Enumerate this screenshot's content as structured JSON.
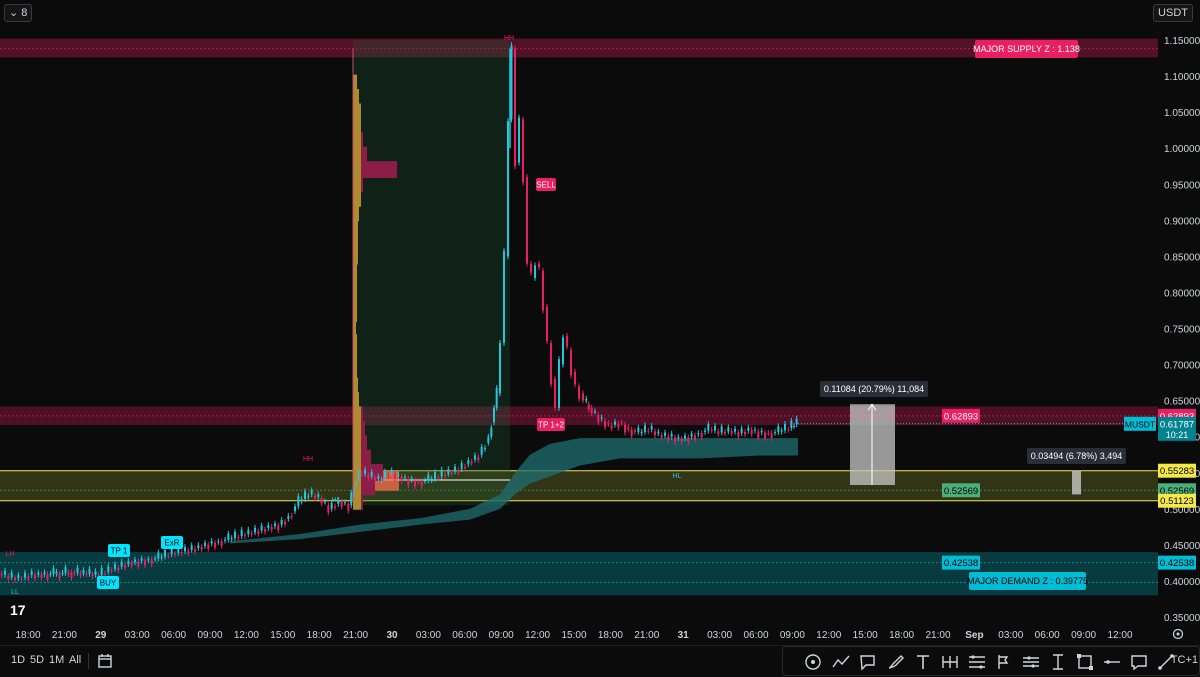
{
  "toolbar": {
    "menu_label": "8",
    "quote_currency": "USDT",
    "timeframes": [
      "1D",
      "5D",
      "1M",
      "All"
    ],
    "timezone": "TC+1"
  },
  "labels": {
    "major_supply": "MAJOR SUPPLY Z : 1.138",
    "major_demand": "MAJOR DEMAND Z : 0.39775",
    "sell": "SELL",
    "buy": "BUY",
    "tp1": "TP 1",
    "exit": "ExR",
    "tp12": "TP 1+2",
    "hh_top": "HH",
    "hh_left": "HH",
    "hl_left": "HL",
    "hl_right": "HL",
    "lh": "LH",
    "ll": "LL",
    "measure_top": "0.11084 (20.79%) 11,084",
    "measure_bottom": "0.03494 (6.78%) 3,494",
    "symbol": "MUSDT",
    "countdown": "10:21"
  },
  "colors": {
    "supply": "#e91e63",
    "demand": "#00bcd4",
    "yellow_line": "#f5e84c",
    "candle_up": "#26c6da",
    "candle_down": "#e91e63",
    "ribbon": "#1f6f72"
  },
  "chart_data": {
    "type": "candlestick",
    "pair": "MUSDT",
    "last_price": 0.61787,
    "y_ticks": [
      1.15,
      1.1,
      1.05,
      1.0,
      0.95,
      0.9,
      0.85,
      0.8,
      0.75,
      0.7,
      0.65,
      0.6,
      0.55,
      0.5,
      0.45,
      0.4,
      0.35
    ],
    "y_tick_labels": [
      "1.15000",
      "1.10000",
      "1.05000",
      "1.00000",
      "0.95000",
      "0.90000",
      "0.85000",
      "0.80000",
      "0.75000",
      "0.70000",
      "0.65000",
      "0.60000",
      "0.55000",
      "0.50000",
      "0.45000",
      "0.40000",
      "0.35000"
    ],
    "ylim": [
      0.33,
      1.175
    ],
    "x_ticks": [
      "18:00",
      "21:00",
      "29",
      "03:00",
      "06:00",
      "09:00",
      "12:00",
      "15:00",
      "18:00",
      "21:00",
      "30",
      "03:00",
      "06:00",
      "09:00",
      "12:00",
      "15:00",
      "18:00",
      "21:00",
      "31",
      "03:00",
      "06:00",
      "09:00",
      "12:00",
      "15:00",
      "18:00",
      "21:00",
      "Sep",
      "03:00",
      "06:00",
      "09:00",
      "12:00"
    ],
    "price_badges": [
      {
        "label": "0.62893",
        "value": 0.62893,
        "color": "#e91e63"
      },
      {
        "label": "0.55283",
        "value": 0.55283,
        "color": "#f5e84c"
      },
      {
        "label": "0.52569",
        "value": 0.52569,
        "color": "#4caf7a"
      },
      {
        "label": "0.51123",
        "value": 0.51123,
        "color": "#f5e84c"
      },
      {
        "label": "0.42538",
        "value": 0.42538,
        "color": "#00bcd4"
      }
    ],
    "zones": {
      "supply_major": [
        1.126,
        1.152
      ],
      "supply_minor": [
        0.616,
        0.642
      ],
      "yellow": [
        0.51123,
        0.55283
      ],
      "demand": [
        0.38,
        0.44
      ]
    },
    "price_path": [
      [
        0,
        0.41
      ],
      [
        10,
        0.405
      ],
      [
        20,
        0.403
      ],
      [
        30,
        0.408
      ],
      [
        40,
        0.409
      ],
      [
        55,
        0.41
      ],
      [
        70,
        0.412
      ],
      [
        85,
        0.41
      ],
      [
        100,
        0.408
      ],
      [
        110,
        0.415
      ],
      [
        120,
        0.42
      ],
      [
        130,
        0.425
      ],
      [
        140,
        0.428
      ],
      [
        150,
        0.43
      ],
      [
        160,
        0.432
      ],
      [
        170,
        0.437
      ],
      [
        180,
        0.44
      ],
      [
        190,
        0.443
      ],
      [
        200,
        0.447
      ],
      [
        210,
        0.452
      ],
      [
        220,
        0.455
      ],
      [
        230,
        0.458
      ],
      [
        240,
        0.462
      ],
      [
        250,
        0.466
      ],
      [
        260,
        0.47
      ],
      [
        270,
        0.475
      ],
      [
        280,
        0.478
      ],
      [
        290,
        0.49
      ],
      [
        300,
        0.51
      ],
      [
        310,
        0.52
      ],
      [
        320,
        0.515
      ],
      [
        330,
        0.5
      ],
      [
        340,
        0.51
      ],
      [
        350,
        0.505
      ],
      [
        355,
        0.535
      ],
      [
        360,
        0.55
      ],
      [
        370,
        0.545
      ],
      [
        380,
        0.54
      ],
      [
        390,
        0.55
      ],
      [
        400,
        0.545
      ],
      [
        410,
        0.54
      ],
      [
        420,
        0.538
      ],
      [
        430,
        0.54
      ],
      [
        440,
        0.545
      ],
      [
        450,
        0.55
      ],
      [
        460,
        0.555
      ],
      [
        470,
        0.565
      ],
      [
        480,
        0.575
      ],
      [
        490,
        0.6
      ],
      [
        498,
        0.66
      ],
      [
        502,
        0.73
      ],
      [
        506,
        0.85
      ],
      [
        510,
        1.04
      ],
      [
        513,
        1.138
      ],
      [
        517,
        0.98
      ],
      [
        521,
        1.04
      ],
      [
        525,
        0.96
      ],
      [
        529,
        0.84
      ],
      [
        533,
        0.82
      ],
      [
        537,
        0.84
      ],
      [
        541,
        0.83
      ],
      [
        545,
        0.78
      ],
      [
        549,
        0.73
      ],
      [
        553,
        0.68
      ],
      [
        557,
        0.64
      ],
      [
        561,
        0.7
      ],
      [
        565,
        0.74
      ],
      [
        569,
        0.72
      ],
      [
        573,
        0.69
      ],
      [
        577,
        0.67
      ],
      [
        581,
        0.66
      ],
      [
        585,
        0.65
      ],
      [
        590,
        0.64
      ],
      [
        600,
        0.625
      ],
      [
        610,
        0.615
      ],
      [
        620,
        0.62
      ],
      [
        630,
        0.61
      ],
      [
        640,
        0.605
      ],
      [
        650,
        0.61
      ],
      [
        660,
        0.602
      ],
      [
        670,
        0.6
      ],
      [
        680,
        0.597
      ],
      [
        690,
        0.6
      ],
      [
        700,
        0.605
      ],
      [
        710,
        0.61
      ],
      [
        720,
        0.606
      ],
      [
        730,
        0.608
      ],
      [
        740,
        0.605
      ],
      [
        750,
        0.61
      ],
      [
        760,
        0.606
      ],
      [
        770,
        0.605
      ],
      [
        780,
        0.607
      ],
      [
        790,
        0.612
      ],
      [
        798,
        0.62
      ]
    ]
  }
}
